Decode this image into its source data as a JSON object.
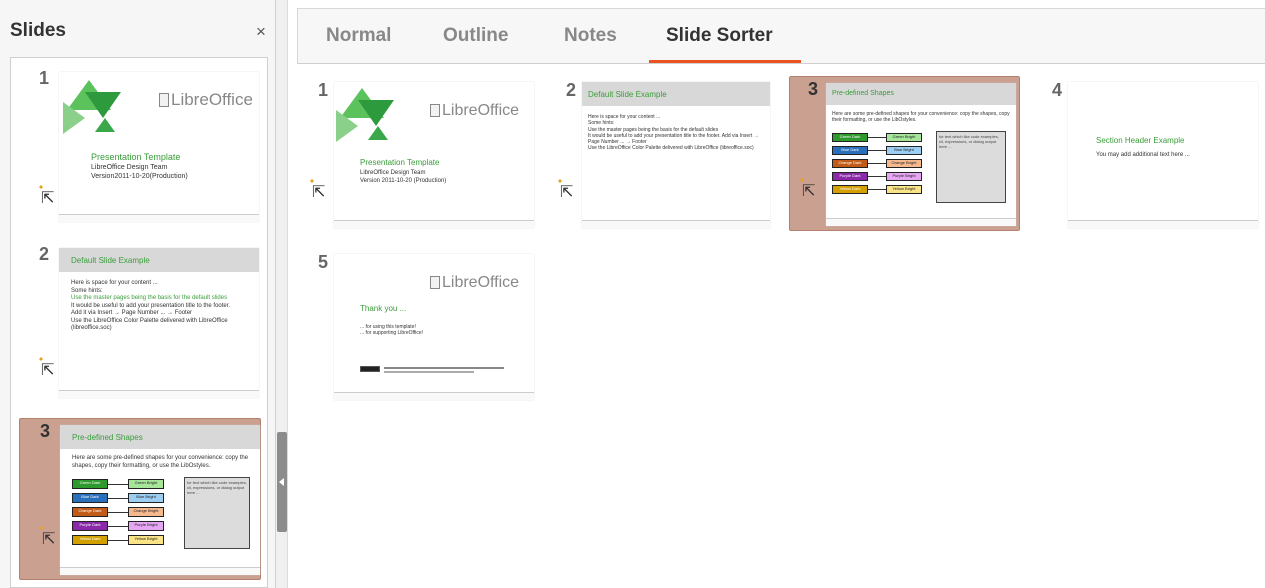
{
  "sidebar": {
    "title": "Slides",
    "close_glyph": "×"
  },
  "view_tabs": [
    {
      "label": "Normal",
      "active": false
    },
    {
      "label": "Outline",
      "active": false
    },
    {
      "label": "Notes",
      "active": false
    },
    {
      "label": "Slide Sorter",
      "active": true
    }
  ],
  "slides": [
    {
      "number": "1",
      "logo": {
        "libre": "Libre",
        "office": "Office"
      },
      "title": "Presentation Template",
      "bullets": [
        "LibreOffice Design Team",
        "Version 2011-10-20 (Production)"
      ],
      "panel_bullets": [
        "LibreOffice Design Team",
        "Version2011-10-20(Production)"
      ]
    },
    {
      "number": "2",
      "title": "Default Slide Example",
      "bullets": [
        "Here is space for your content ...",
        "Some hints:",
        "Use the master pages being the basis for the default slides",
        "It would be useful to add your presentation title to the footer. Add via Insert → Page Number ... → Footer",
        "Use the LibreOffice Color Palette delivered with LibreOffice (libreoffice.soc)"
      ],
      "panel_bullets": [
        "Here is space for your content ...",
        "Some hints:",
        "Use the master pages being the basis for the default slides",
        "It would be useful to add your presentation title to the footer.",
        "Add it via Insert → Page Number ... → Footer",
        "Use the LibreOffice Color Palette delivered with LibreOffice",
        "(libreoffice.soc)"
      ]
    },
    {
      "number": "3",
      "title": "Pre-defined Shapes",
      "intro": "Here are some pre-defined shapes for your convenience: copy the shapes, copy their formatting, or use the LibOstyles.",
      "shapes_dark": [
        "Green Dark",
        "Blue Dark",
        "Orange Dark",
        "Purple Dark",
        "Yellow Dark"
      ],
      "shapes_bright": [
        "Green Bright",
        "Blue Bright",
        "Orange Bright",
        "Purple Bright",
        "Yellow Bright"
      ],
      "gray_box_text": "for text which like code examples, cli, expressions, or dialog output here ...",
      "colors_dark": [
        "#2e9a2e",
        "#2a6fbb",
        "#c25b17",
        "#8b2aa8",
        "#d2a000"
      ],
      "colors_bright": [
        "#a6e59a",
        "#9ccdf3",
        "#f5b88f",
        "#e6a6f3",
        "#fbe487"
      ]
    },
    {
      "number": "4",
      "title": "Section Header Example",
      "bullets": [
        "You may add additional text here ..."
      ]
    },
    {
      "number": "5",
      "logo": {
        "libre": "Libre",
        "office": "Office"
      },
      "title": "Thank you ...",
      "bullets": [
        "... for using this template!",
        "... for supporting LibreOffice!"
      ]
    }
  ],
  "colors": {
    "accent": "#e95420",
    "selected_bg": "#caa090",
    "title_green": "#3a9d3a"
  },
  "icons": {
    "close": "close-icon",
    "transition": "slide-transition-icon"
  }
}
